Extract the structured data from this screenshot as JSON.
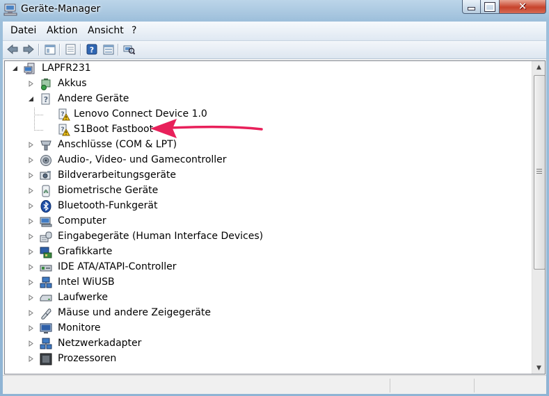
{
  "window": {
    "title": "Geräte-Manager",
    "icon": "device-manager-icon"
  },
  "menu": [
    {
      "label": "Datei"
    },
    {
      "label": "Aktion"
    },
    {
      "label": "Ansicht"
    },
    {
      "label": "?"
    }
  ],
  "toolbar": [
    {
      "name": "back-button",
      "icon": "arrow-left-icon"
    },
    {
      "name": "forward-button",
      "icon": "arrow-right-icon"
    },
    {
      "name": "show-hide-console-tree-button",
      "icon": "console-tree-icon"
    },
    {
      "name": "properties-button",
      "icon": "properties-icon"
    },
    {
      "name": "help-button",
      "icon": "help-icon"
    },
    {
      "name": "update-driver-button",
      "icon": "update-driver-icon"
    },
    {
      "name": "scan-hardware-button",
      "icon": "scan-hardware-icon"
    }
  ],
  "tree": {
    "root": {
      "label": "LAPFR231",
      "expanded": true,
      "icon": "computer-icon"
    },
    "items": [
      {
        "label": "Akkus",
        "icon": "battery-icon",
        "expanded": false
      },
      {
        "label": "Andere Geräte",
        "icon": "unknown-device-icon",
        "expanded": true,
        "children": [
          {
            "label": "Lenovo Connect Device 1.0",
            "icon": "warning-device-icon"
          },
          {
            "label": "S1Boot Fastboot",
            "icon": "warning-device-icon"
          }
        ]
      },
      {
        "label": "Anschlüsse (COM & LPT)",
        "icon": "port-icon",
        "expanded": false
      },
      {
        "label": "Audio-, Video- und Gamecontroller",
        "icon": "speaker-icon",
        "expanded": false
      },
      {
        "label": "Bildverarbeitungsgeräte",
        "icon": "camera-icon",
        "expanded": false
      },
      {
        "label": "Biometrische Geräte",
        "icon": "fingerprint-icon",
        "expanded": false
      },
      {
        "label": "Bluetooth-Funkgerät",
        "icon": "bluetooth-icon",
        "expanded": false
      },
      {
        "label": "Computer",
        "icon": "computer-icon",
        "expanded": false
      },
      {
        "label": "Eingabegeräte (Human Interface Devices)",
        "icon": "hid-icon",
        "expanded": false
      },
      {
        "label": "Grafikkarte",
        "icon": "display-adapter-icon",
        "expanded": false
      },
      {
        "label": "IDE ATA/ATAPI-Controller",
        "icon": "ide-controller-icon",
        "expanded": false
      },
      {
        "label": "Intel WiUSB",
        "icon": "network-icon",
        "expanded": false
      },
      {
        "label": "Laufwerke",
        "icon": "disk-drive-icon",
        "expanded": false
      },
      {
        "label": "Mäuse und andere Zeigegeräte",
        "icon": "mouse-icon",
        "expanded": false
      },
      {
        "label": "Monitore",
        "icon": "monitor-icon",
        "expanded": false
      },
      {
        "label": "Netzwerkadapter",
        "icon": "network-icon",
        "expanded": false
      },
      {
        "label": "Prozessoren",
        "icon": "processor-icon",
        "expanded": false
      }
    ]
  },
  "annotation": {
    "type": "arrow",
    "color": "#e8205a",
    "points_to": "S1Boot Fastboot"
  },
  "colors": {
    "titlebar": "#9dbfdb",
    "close_button": "#c7432c",
    "warning": "#f0c419"
  }
}
